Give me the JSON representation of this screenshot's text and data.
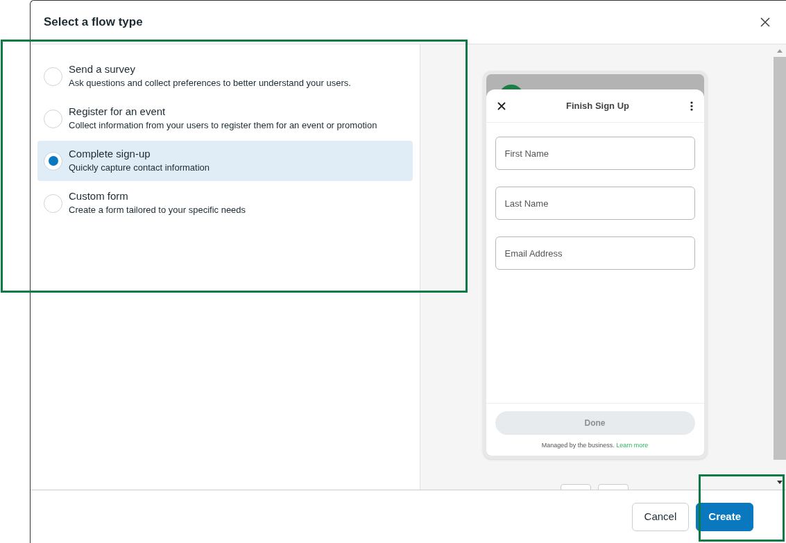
{
  "dialog": {
    "title": "Select a flow type"
  },
  "options": [
    {
      "title": "Send a survey",
      "description": "Ask questions and collect preferences to better understand your users.",
      "selected": false
    },
    {
      "title": "Register for an event",
      "description": "Collect information from your users to register them for an event or promotion",
      "selected": false
    },
    {
      "title": "Complete sign-up",
      "description": "Quickly capture contact information",
      "selected": true
    },
    {
      "title": "Custom form",
      "description": "Create a form tailored to your specific needs",
      "selected": false
    }
  ],
  "preview": {
    "title": "Finish Sign Up",
    "fields": [
      {
        "placeholder": "First Name"
      },
      {
        "placeholder": "Last Name"
      },
      {
        "placeholder": "Email Address"
      }
    ],
    "done_button": "Done",
    "note": "Managed by the business.",
    "link": "Learn more"
  },
  "footer": {
    "buttons": [
      {
        "label": "Cancel",
        "kind": "secondary"
      },
      {
        "label": "Create",
        "kind": "primary"
      }
    ]
  }
}
